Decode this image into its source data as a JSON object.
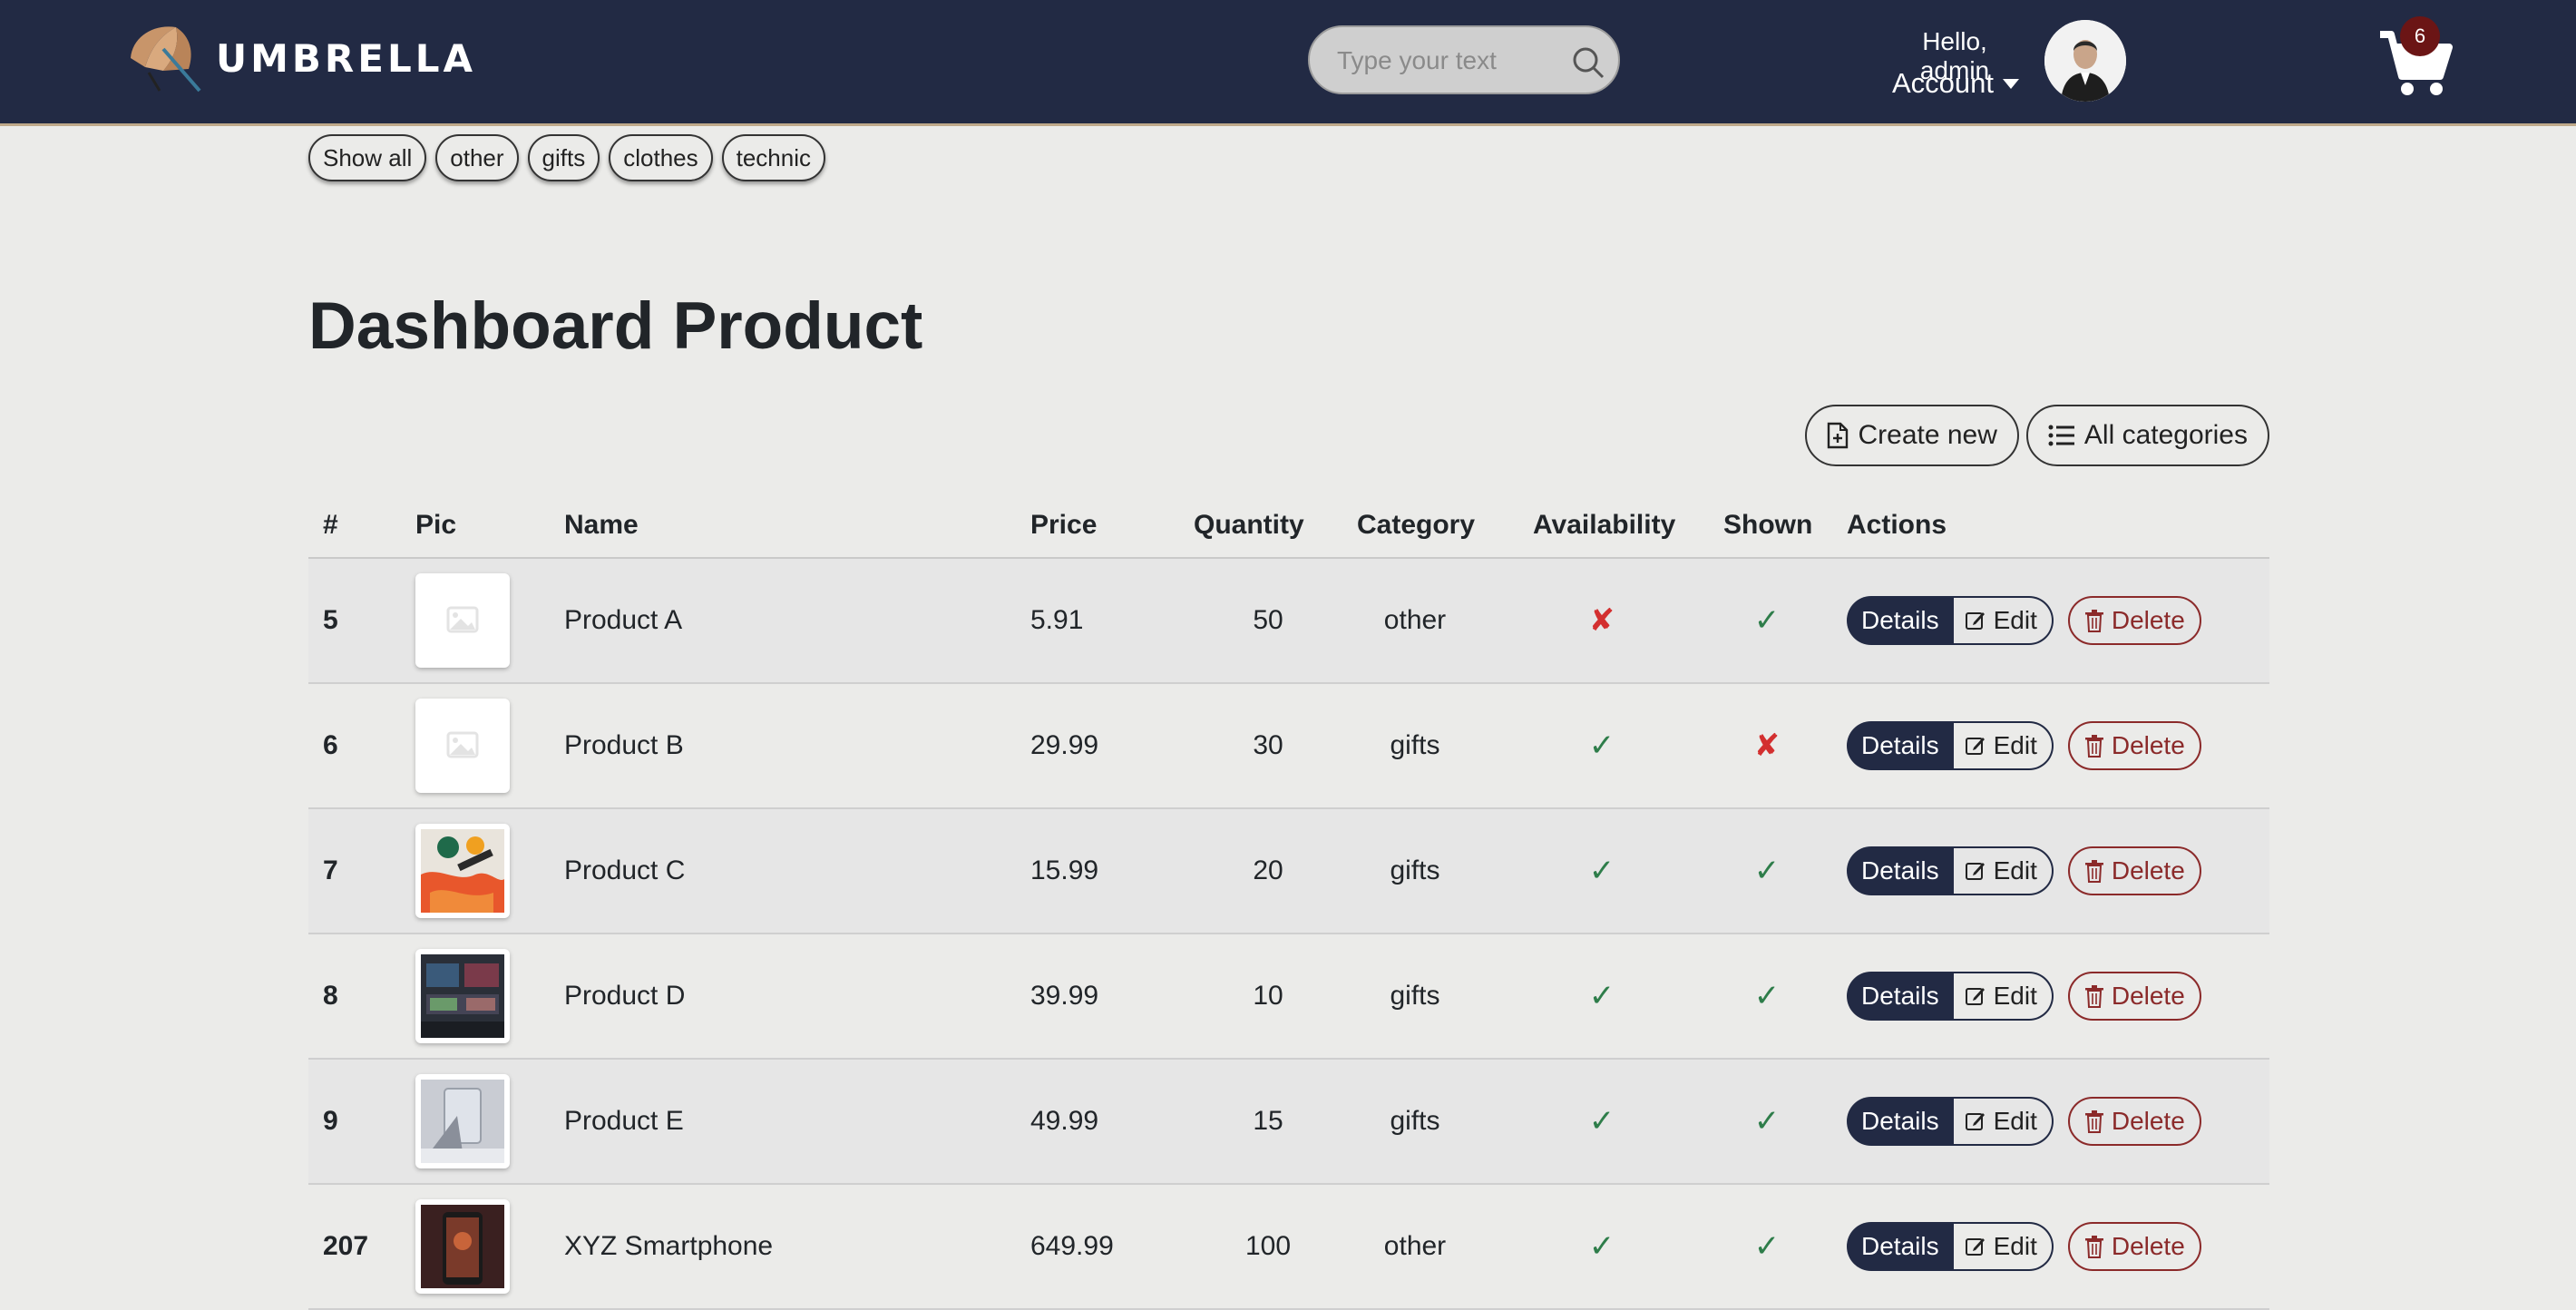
{
  "header": {
    "brand": "UMBRELLA",
    "search_placeholder": "Type your text",
    "greeting": "Hello, admin",
    "account_label": "Account",
    "cart_count": "6"
  },
  "filters": [
    "Show all",
    "other",
    "gifts",
    "clothes",
    "technic"
  ],
  "page_title": "Dashboard Product",
  "actions": {
    "create_new": "Create new",
    "all_categories": "All categories"
  },
  "table": {
    "headers": [
      "#",
      "Pic",
      "Name",
      "Price",
      "Quantity",
      "Category",
      "Availability",
      "Shown",
      "Actions"
    ],
    "row_buttons": {
      "details": "Details",
      "edit": "Edit",
      "delete": "Delete"
    },
    "rows": [
      {
        "id": "5",
        "name": "Product A",
        "price": "5.91",
        "qty": "50",
        "category": "other",
        "available": false,
        "shown": true,
        "pic": "placeholder"
      },
      {
        "id": "6",
        "name": "Product B",
        "price": "29.99",
        "qty": "30",
        "category": "gifts",
        "available": true,
        "shown": false,
        "pic": "placeholder"
      },
      {
        "id": "7",
        "name": "Product C",
        "price": "15.99",
        "qty": "20",
        "category": "gifts",
        "available": true,
        "shown": true,
        "pic": "paint"
      },
      {
        "id": "8",
        "name": "Product D",
        "price": "39.99",
        "qty": "10",
        "category": "gifts",
        "available": true,
        "shown": true,
        "pic": "gaming"
      },
      {
        "id": "9",
        "name": "Product E",
        "price": "49.99",
        "qty": "15",
        "category": "gifts",
        "available": true,
        "shown": true,
        "pic": "glass"
      },
      {
        "id": "207",
        "name": "XYZ Smartphone",
        "price": "649.99",
        "qty": "100",
        "category": "other",
        "available": true,
        "shown": true,
        "pic": "phone"
      }
    ]
  },
  "colors": {
    "nav_bg": "#222a44",
    "page_bg": "#ebebe9",
    "check": "#2e7d4a",
    "cross": "#d32f2f",
    "delete": "#8b2a2a"
  }
}
